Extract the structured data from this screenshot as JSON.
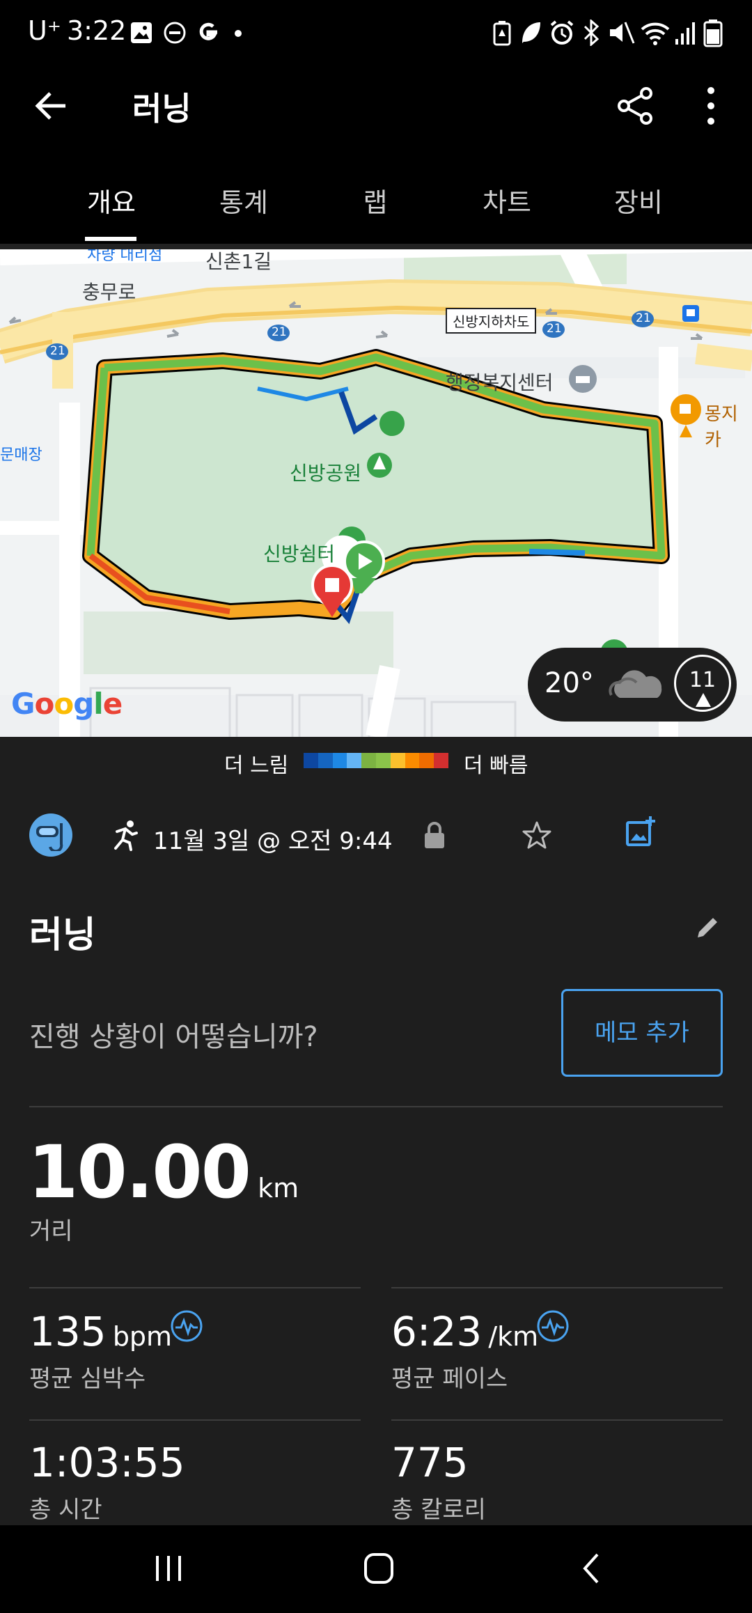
{
  "status_bar": {
    "carrier": "U⁺",
    "time": "3:22"
  },
  "app_bar": {
    "title": "러닝"
  },
  "tabs": [
    {
      "label": "개요",
      "active": true
    },
    {
      "label": "통계",
      "active": false
    },
    {
      "label": "랩",
      "active": false
    },
    {
      "label": "차트",
      "active": false
    },
    {
      "label": "장비",
      "active": false
    }
  ],
  "map": {
    "labels": {
      "street1": "신촌1길",
      "road_chungmuro": "충무로",
      "underpass": "신방지하차도",
      "route_number": "21",
      "office": "행정복지센터",
      "park": "신방공원",
      "shelter": "신방쉼터",
      "shop_left": "문매장",
      "cafe": "몽지카",
      "top_left": "차량 대리점",
      "logo": "Google"
    },
    "weather": {
      "temperature": "20°",
      "wind": "11"
    }
  },
  "legend": {
    "slow": "더 느림",
    "fast": "더 빠름",
    "colors": [
      "#0d47a1",
      "#1565c0",
      "#1e88e5",
      "#64b5f6",
      "#7cb342",
      "#8bc34a",
      "#fbc02d",
      "#fb8c00",
      "#ef6c00",
      "#d32f2f"
    ]
  },
  "activity": {
    "date": "11월 3일 @ 오전 9:44",
    "name": "러닝",
    "prompt": "진행 상황이 어떻습니까?",
    "memo_button": "메모 추가",
    "distance": {
      "value": "10.00",
      "unit": "km",
      "label": "거리"
    },
    "avg_hr": {
      "value": "135",
      "unit": "bpm",
      "label": "평균 심박수"
    },
    "avg_pace": {
      "value": "6:23",
      "unit": "/km",
      "label": "평균 페이스"
    },
    "total_time": {
      "value": "1:03:55",
      "label": "총 시간"
    },
    "calories": {
      "value": "775",
      "label": "총 칼로리"
    }
  },
  "colors": {
    "accent_blue": "#4aa3f0",
    "route_green": "#6cc04a",
    "start_green": "#4caf50",
    "stop_red": "#e53935"
  }
}
